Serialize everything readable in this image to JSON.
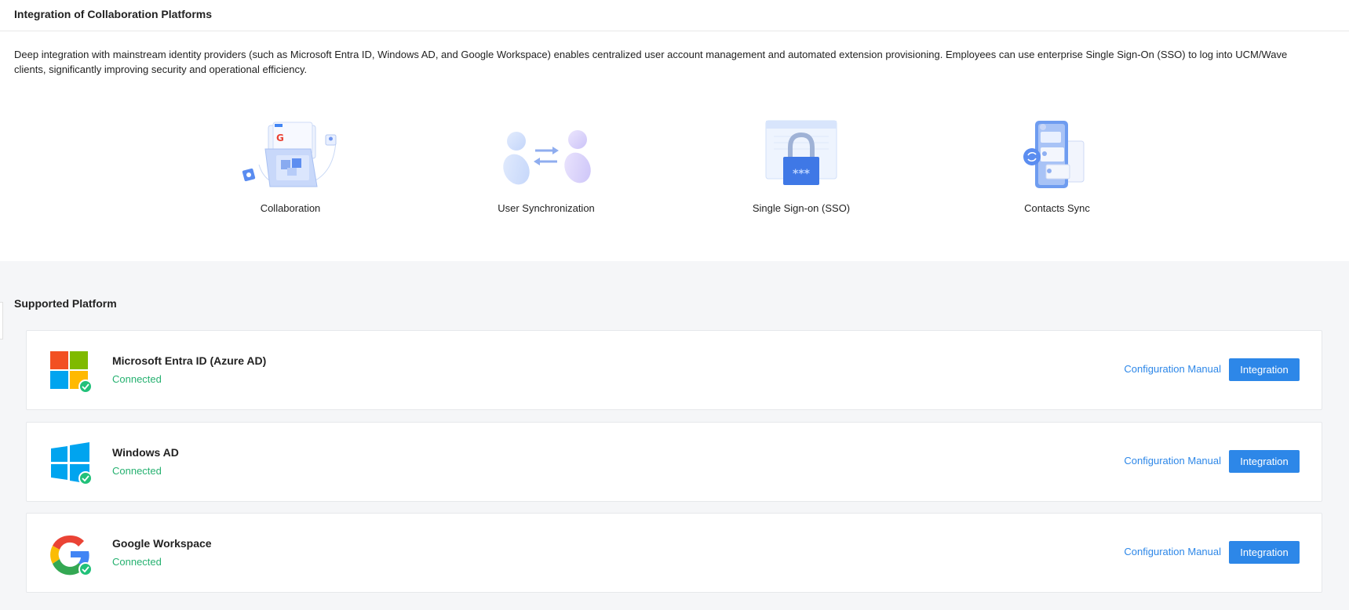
{
  "header": {
    "title": "Integration of Collaboration Platforms"
  },
  "description": "Deep integration with mainstream identity providers (such as Microsoft Entra ID, Windows AD, and Google Workspace) enables centralized user account management and automated extension provisioning. Employees can use enterprise Single Sign-On (SSO) to log into UCM/Wave clients, significantly improving security and operational efficiency.",
  "features": [
    {
      "label": "Collaboration",
      "icon": "collaboration-illustration"
    },
    {
      "label": "User Synchronization",
      "icon": "user-sync-illustration"
    },
    {
      "label": "Single Sign-on (SSO)",
      "icon": "sso-lock-illustration"
    },
    {
      "label": "Contacts Sync",
      "icon": "contacts-sync-illustration"
    }
  ],
  "platforms": {
    "title": "Supported Platform",
    "items": [
      {
        "name": "Microsoft Entra ID (Azure AD)",
        "status": "Connected",
        "manual": "Configuration Manual",
        "button": "Integration",
        "icon": "microsoft-logo-icon"
      },
      {
        "name": "Windows AD",
        "status": "Connected",
        "manual": "Configuration Manual",
        "button": "Integration",
        "icon": "windows-logo-icon"
      },
      {
        "name": "Google Workspace",
        "status": "Connected",
        "manual": "Configuration Manual",
        "button": "Integration",
        "icon": "google-logo-icon"
      }
    ]
  },
  "colors": {
    "accent": "#2d87e8",
    "connected": "#26b170",
    "check": "#22c17a"
  }
}
